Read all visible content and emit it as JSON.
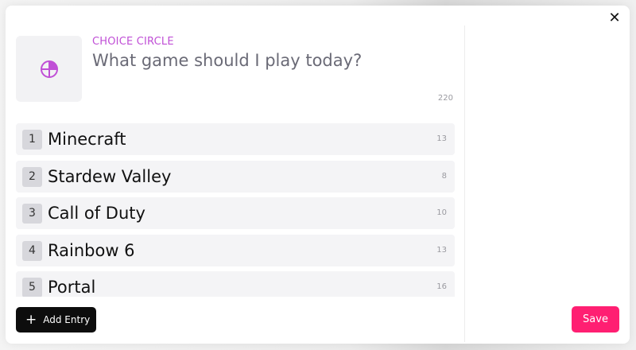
{
  "header": {
    "type_label": "CHOICE CIRCLE",
    "title": "What game should I play today?",
    "title_char_count": "220",
    "thumbnail_icon": "pie-chart-icon",
    "accent_color": "#c04fd6"
  },
  "entries": [
    {
      "index": "1",
      "name": "Minecraft",
      "count": "13"
    },
    {
      "index": "2",
      "name": "Stardew Valley",
      "count": "8"
    },
    {
      "index": "3",
      "name": "Call of Duty",
      "count": "10"
    },
    {
      "index": "4",
      "name": "Rainbow 6",
      "count": "13"
    },
    {
      "index": "5",
      "name": "Portal",
      "count": "16"
    }
  ],
  "footer": {
    "add_entry_label": "Add Entry",
    "save_label": "Save",
    "save_color": "#ff1f72"
  },
  "window": {
    "close_icon": "close-icon"
  }
}
